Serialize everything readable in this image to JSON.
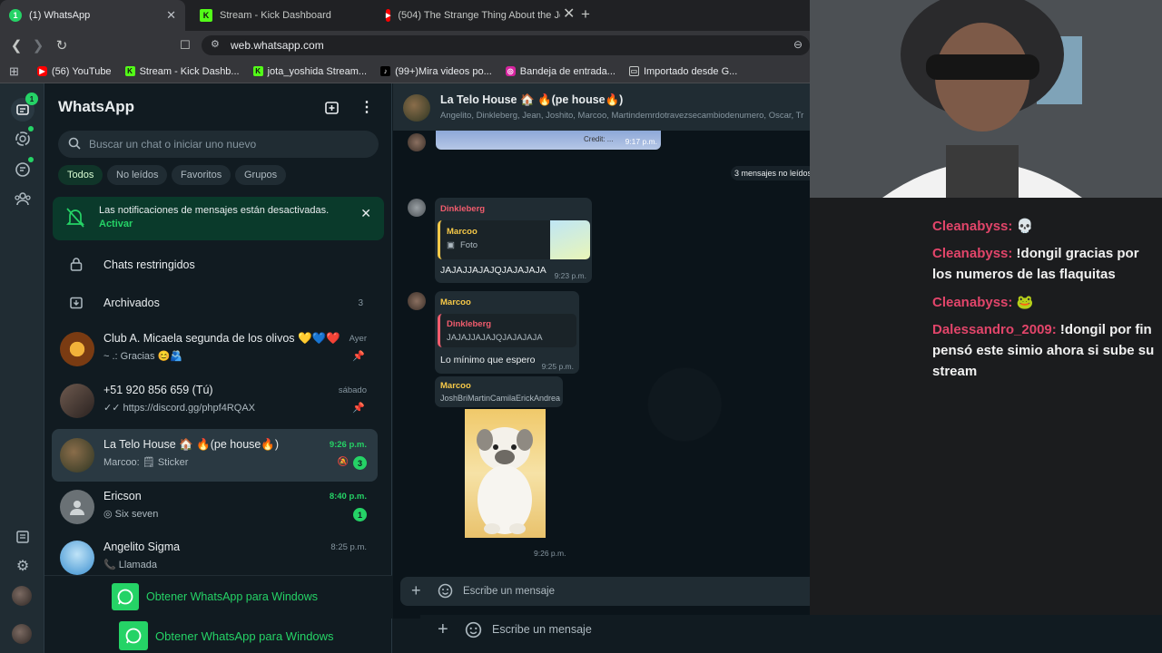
{
  "browser": {
    "tabs": [
      {
        "title": "(1) WhatsApp",
        "badge": "1",
        "color": "#25d366"
      },
      {
        "title": "Stream - Kick Dashboard",
        "badge": "K",
        "color": "#53fc18"
      },
      {
        "title": "(504) The Strange Thing About the Jo",
        "badge": "▶",
        "color": "#ff0000"
      }
    ],
    "url": "web.whatsapp.com",
    "bookmarks": [
      {
        "label": "(56) YouTube",
        "icon": "youtube-icon",
        "color": "#ff0000",
        "glyph": "▶"
      },
      {
        "label": "Stream - Kick Dashb...",
        "icon": "kick-icon",
        "color": "#53fc18",
        "glyph": "K"
      },
      {
        "label": "jota_yoshida Stream...",
        "icon": "kick-icon",
        "color": "#53fc18",
        "glyph": "K"
      },
      {
        "label": "(99+)Mira videos po...",
        "icon": "tiktok-icon",
        "color": "#000000",
        "glyph": "♪"
      },
      {
        "label": "Bandeja de entrada...",
        "icon": "instagram-icon",
        "color": "#d6249f",
        "glyph": "◎"
      },
      {
        "label": "Importado desde G...",
        "icon": "folder-icon",
        "color": "#35363a",
        "glyph": "▭"
      }
    ]
  },
  "whatsapp": {
    "title": "WhatsApp",
    "rail_badge": "1",
    "search_placeholder": "Buscar un chat o iniciar uno nuevo",
    "filters": [
      "Todos",
      "No leídos",
      "Favoritos",
      "Grupos"
    ],
    "notification": {
      "text": "Las notificaciones de mensajes están desactivadas.",
      "action": "Activar"
    },
    "restricted": "Chats restringidos",
    "archived": {
      "label": "Archivados",
      "count": "3"
    },
    "chats": [
      {
        "name": "Club A. Micaela segunda de los olivos 💛💙❤️",
        "msg": "~ .: Gracias 😊🫂",
        "time": "Ayer",
        "pinned": true,
        "avatar": "#7a3b12"
      },
      {
        "name": "+51 920 856 659 (Tú)",
        "msg": "✓✓ https://discord.gg/phpf4RQAX",
        "time": "sábado",
        "pinned": true,
        "avatar": "#4b3a33"
      },
      {
        "name": "La Telo House 🏠 🔥(pe house🔥)",
        "msg": "Marcoo: 🗒 Sticker",
        "time": "9:26 p.m.",
        "badge": "3",
        "muted": true,
        "avatar": "#3f4a2c"
      },
      {
        "name": "Ericson",
        "msg": "◎ Six seven",
        "time": "8:40 p.m.",
        "badge": "1",
        "avatar": "#6a7175"
      },
      {
        "name": "Angelito Sigma",
        "msg": "📞 Llamada",
        "time": "8:25 p.m.",
        "avatar": "#5aa3d9"
      }
    ],
    "get_app": "Obtener WhatsApp para Windows",
    "get_app2": "Obtener WhatsApp para Windows"
  },
  "chat": {
    "title": "La Telo House 🏠 🔥(pe house🔥)",
    "members": "Angelito, Dinkleberg, Jean, Joshito, Marcoo, Martindemrdotravezsecambiodenumero, Oscar, Tr",
    "top_image_time": "9:17 p.m.",
    "top_image_caption": "Credit: ...",
    "unread": "3 mensajes no leídos",
    "messages": [
      {
        "sender": "Dinkleberg",
        "quote_sender": "Marcoo",
        "quote_text": "Foto",
        "text": "JAJAJJAJAJQJAJAJAJA",
        "time": "9:23 p.m."
      },
      {
        "sender": "Marcoo",
        "quote_sender": "Dinkleberg",
        "quote_text": "JAJAJJAJAJQJAJAJAJA",
        "text": "Lo mínimo que espero",
        "time": "9:25 p.m."
      },
      {
        "sender": "Marcoo",
        "text": "JoshBriMartinCamilaErickAndrea",
        "time": "9:26 p.m."
      }
    ],
    "composer_placeholder": "Escribe un mensaje",
    "composer_placeholder2": "Escribe un mensaje"
  },
  "stream_chat": [
    {
      "user": "Cleanabyss:",
      "text": " 💀"
    },
    {
      "user": "Cleanabyss:",
      "text": " !dongil gracias por los numeros de las flaquitas"
    },
    {
      "user": "Cleanabyss:",
      "text": " 🐸"
    },
    {
      "user": "Dalessandro_2009:",
      "text": " !dongil por fin pensó este simio ahora si sube su stream"
    }
  ]
}
